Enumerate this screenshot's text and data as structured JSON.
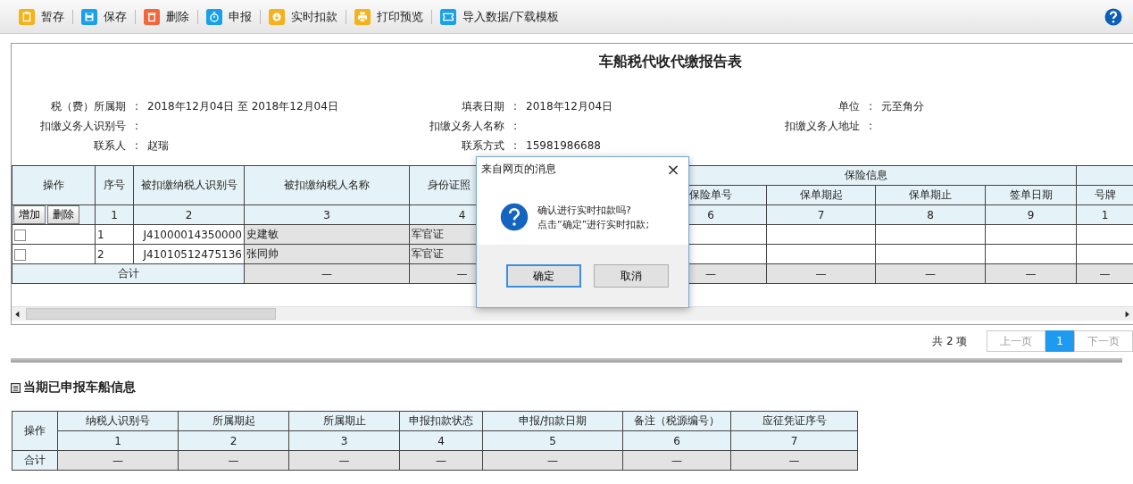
{
  "toolbar": {
    "buttons": [
      {
        "label": "暂存"
      },
      {
        "label": "保存"
      },
      {
        "label": "删除"
      },
      {
        "label": "申报"
      },
      {
        "label": "实时扣款"
      },
      {
        "label": "打印预览"
      },
      {
        "label": "导入数据/下载模板"
      }
    ]
  },
  "report": {
    "title": "车船税代收代缴报告表",
    "fields": [
      [
        {
          "label": "税（费）所属期",
          "separator": ":",
          "value": "2018年12月04日 至 2018年12月04日"
        },
        {
          "label": "填表日期",
          "separator": ":",
          "value": "2018年12月04日"
        },
        {
          "label": "单位",
          "separator": ":",
          "value": "元至角分"
        }
      ],
      [
        {
          "label": "扣缴义务人识别号",
          "separator": ":"
        },
        {
          "label": "扣缴义务人名称",
          "separator": ":"
        },
        {
          "label": "扣缴义务人地址",
          "separator": ":"
        }
      ],
      [
        {
          "label": "联系人",
          "separator": ":",
          "value": "赵瑞"
        },
        {
          "label": "联系方式",
          "separator": ":",
          "value": "15981986688"
        }
      ]
    ],
    "table": {
      "action_header": "操作",
      "add_button": "增加",
      "delete_button": "删除",
      "total_label": "合计",
      "columns": [
        {
          "kind": "seq",
          "label": "序号",
          "number": "1"
        },
        {
          "kind": "taxid",
          "label": "被扣缴纳税人识别号",
          "number": "2"
        },
        {
          "kind": "name",
          "label": "被扣缴纳税人名称",
          "number": "3",
          "total": "—"
        },
        {
          "kind": "doc",
          "label": "身份证照",
          "number": "4",
          "total": "—"
        },
        {
          "kind": "covered"
        },
        {
          "kind": "group",
          "label": "保险信息",
          "children": [
            {
              "label": "保险单号",
              "number": "6",
              "total": "—"
            },
            {
              "label": "保单期起",
              "number": "7",
              "total": "—"
            },
            {
              "label": "保单期止",
              "number": "8",
              "total": "—"
            },
            {
              "label": "签单日期",
              "number": "9",
              "total": "—"
            }
          ]
        },
        {
          "kind": "group",
          "children": [
            {
              "label": "号牌",
              "number": "1",
              "total": "—"
            }
          ]
        }
      ],
      "rows": [
        {
          "checked": false,
          "cells": [
            "1",
            "J41000014350000",
            "史建敏",
            "军官证"
          ]
        },
        {
          "checked": false,
          "cells": [
            "2",
            "J41010512475136",
            "张同帅",
            "军官证"
          ]
        }
      ]
    }
  },
  "pagination": {
    "summary": "共 2 项",
    "prev": "上一页",
    "pages": [
      {
        "label": "1",
        "selected": true
      }
    ],
    "next": "下一页"
  },
  "declared": {
    "heading": "当期已申报车船信息",
    "table": {
      "action_header": "操作",
      "total_label": "合计",
      "columns": [
        {
          "label": "纳税人识别号",
          "number": "1",
          "total": "—"
        },
        {
          "label": "所属期起",
          "number": "2",
          "total": "—"
        },
        {
          "label": "所属期止",
          "number": "3",
          "total": "—"
        },
        {
          "label": "申报扣款状态",
          "number": "4",
          "total": "—"
        },
        {
          "label": "申报/扣款日期",
          "number": "5",
          "total": "—"
        },
        {
          "label": "备注（税源编号）",
          "number": "6",
          "total": "—"
        },
        {
          "label": "应征凭证序号",
          "number": "7",
          "total": "—"
        }
      ]
    }
  },
  "dialog": {
    "title": "来自网页的消息",
    "close": "×",
    "lines": [
      "确认进行实时扣款吗?",
      "点击“确定”进行实时扣款;"
    ],
    "buttons": [
      {
        "label": "确定",
        "focused": true
      },
      {
        "label": "取消",
        "focused": false
      }
    ]
  }
}
